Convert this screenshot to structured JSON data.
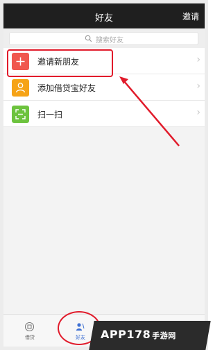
{
  "header": {
    "title": "好友",
    "invite_label": "邀请"
  },
  "search": {
    "placeholder": "搜索好友",
    "icon": "search-icon"
  },
  "list": {
    "items": [
      {
        "label": "邀请新朋友",
        "icon": "plus-icon",
        "color": "#f0574e"
      },
      {
        "label": "添加借贷宝好友",
        "icon": "person-icon",
        "color": "#f6a316"
      },
      {
        "label": "扫一扫",
        "icon": "scan-icon",
        "color": "#6dc33e"
      }
    ]
  },
  "bottom_tabs": [
    {
      "label": "借贷",
      "icon": "circle-icon"
    },
    {
      "label": "好友",
      "icon": "friends-icon",
      "active": true
    }
  ],
  "watermark": {
    "text": "APP178",
    "cn": "手游网"
  },
  "colors": {
    "accent": "#e11b2b",
    "header_bg": "#1f1f1f",
    "active_tab": "#3d6fd3"
  }
}
